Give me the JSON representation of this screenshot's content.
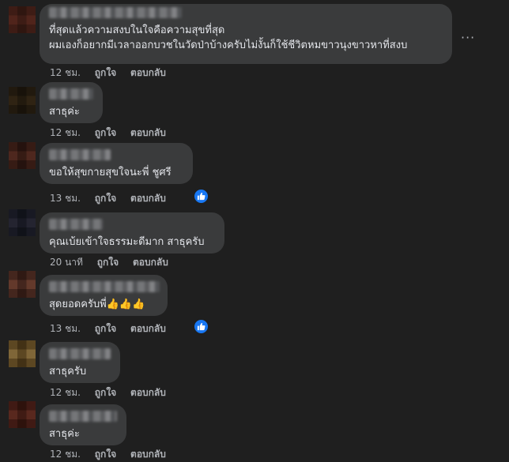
{
  "actions": {
    "like": "ถูกใจ",
    "reply": "ตอบกลับ"
  },
  "more_glyph": "···",
  "colors": {
    "bubble": "#3a3b3c",
    "background": "#1f1f1f",
    "like_blue": "#1877f2"
  },
  "comments": [
    {
      "lines": [
        "ที่สุดแล้วความสงบในใจคือความสุขที่สุด",
        "ผมเองก็อยากมีเวลาออกบวชในวัดป่าบ้างครับไม่งั้นก็ใช้ชีวิตหมขาวนุงขาวหาที่สงบ"
      ],
      "time": "12 ชม.",
      "avatar_colors": [
        "#b98979",
        "#8d6a5e"
      ]
    },
    {
      "lines": [
        "สาธุค่ะ"
      ],
      "time": "12 ชม.",
      "avatar_colors": [
        "#9a8a6c",
        "#6e6450"
      ]
    },
    {
      "lines": [
        "ขอให้สุขกายสุขใจนะพี่ ชูศรี"
      ],
      "time": "13 ชม.",
      "has_like": true,
      "avatar_colors": [
        "#b88f80",
        "#7f6258"
      ]
    },
    {
      "lines": [
        "คุณเบ้ยเข้าใจธรรมะดีมาก สาธุครับ"
      ],
      "time": "20 นาที",
      "avatar_colors": [
        "#8c8c9a",
        "#5e6270"
      ]
    },
    {
      "lines": [
        "สุดยอดครับพี่"
      ],
      "emoji": "👍👍👍",
      "time": "13 ชม.",
      "has_like": true,
      "avatar_colors": [
        "#c7a292",
        "#8a6c62"
      ]
    },
    {
      "lines": [
        "สาธุครับ"
      ],
      "time": "12 ชม.",
      "avatar_colors": [
        "#d6c7a2",
        "#9c8a60"
      ]
    },
    {
      "lines": [
        "สาธุค่ะ"
      ],
      "time": "12 ชม.",
      "avatar_colors": [
        "#c09080",
        "#8a5f52"
      ]
    }
  ]
}
